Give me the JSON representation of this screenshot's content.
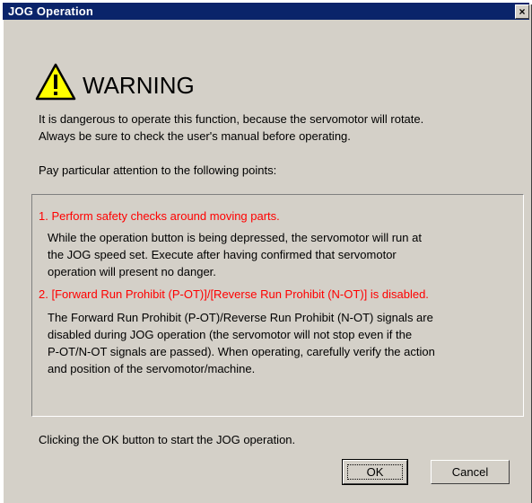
{
  "window": {
    "title": "JOG Operation",
    "close_symbol": "×"
  },
  "warning": {
    "icon": "warning-triangle-icon",
    "heading": "WARNING"
  },
  "intro": {
    "line1": "It is dangerous to operate this function, because the servomotor will rotate.",
    "line2": "Always be sure to check the user's manual before operating.",
    "line3": "Pay particular attention to the following points:"
  },
  "points": [
    {
      "heading": "1. Perform safety checks around moving parts.",
      "lines": [
        " While the operation button is being depressed, the servomotor will run at",
        "the JOG speed set. Execute after having confirmed that servomotor",
        "operation will present no danger."
      ]
    },
    {
      "heading": "2. [Forward Run Prohibit (P-OT)]/[Reverse Run Prohibit (N-OT)] is disabled.",
      "lines": [
        "The Forward Run Prohibit (P-OT)/Reverse Run Prohibit (N-OT) signals are",
        "disabled during JOG operation (the servomotor will not stop even if the",
        "P-OT/N-OT signals are passed). When operating, carefully verify the action",
        "and position of the  servomotor/machine."
      ]
    }
  ],
  "footer": {
    "text": "Clicking the OK button to start the JOG operation."
  },
  "buttons": {
    "ok": "OK",
    "cancel": "Cancel"
  },
  "colors": {
    "titlebar": "#0a246a",
    "dialog_bg": "#d4d0c8",
    "point_heading": "#ff0000",
    "warning_fill": "#ffff00"
  }
}
